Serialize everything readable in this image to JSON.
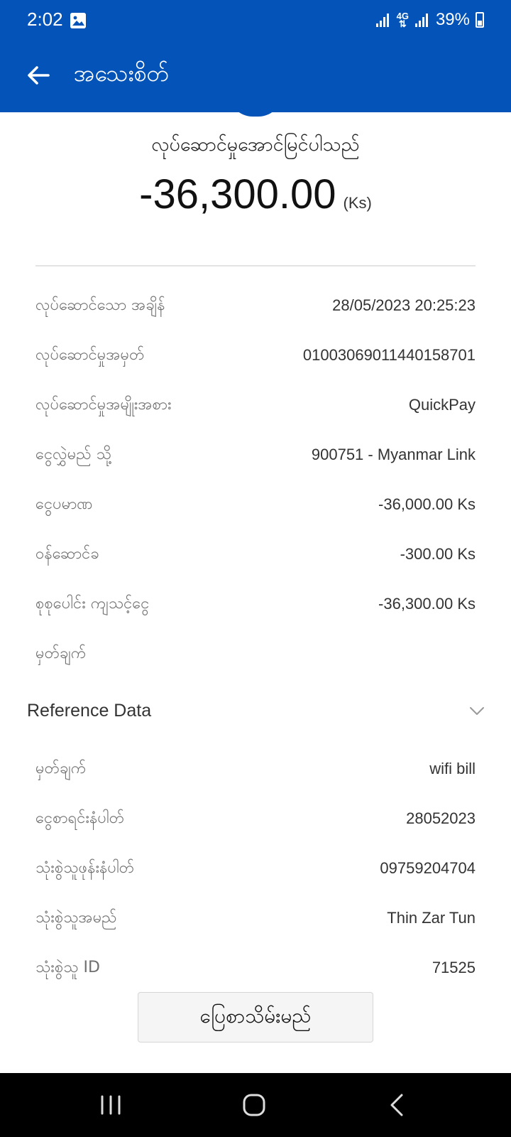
{
  "status_bar": {
    "time": "2:02",
    "network": "4G",
    "battery": "39%",
    "battery_level": 0.39,
    "icons": [
      "gallery-icon",
      "signal-icon",
      "signal-icon",
      "battery-icon"
    ]
  },
  "app_bar": {
    "title": "အသေးစိတ်",
    "back_icon": "arrow-left-icon",
    "color": "#0453b8"
  },
  "summary": {
    "status": "လုပ်ဆောင်မှုအောင်မြင်ပါသည်",
    "amount": "-36,300.00",
    "unit": "(Ks)"
  },
  "details": [
    {
      "label": "လုပ်ဆောင်သော အချိန်",
      "value": "28/05/2023 20:25:23"
    },
    {
      "label": "လုပ်ဆောင်မှုအမှတ်",
      "value": "01003069011440158701"
    },
    {
      "label": "လုပ်ဆောင်မှုအမျိုးအစား",
      "value": "QuickPay"
    },
    {
      "label": "ငွေလွှဲမည် သို့",
      "value": "900751 - Myanmar Link"
    },
    {
      "label": "ငွေပမာဏ",
      "value": "-36,000.00 Ks"
    },
    {
      "label": "ဝန်ဆောင်ခ",
      "value": "-300.00 Ks"
    },
    {
      "label": "စုစုပေါင်း ကျသင့်ငွေ",
      "value": "-36,300.00 Ks"
    },
    {
      "label": "မှတ်ချက်",
      "value": ""
    }
  ],
  "reference": {
    "title": "Reference Data",
    "chevron_icon": "chevron-down-icon",
    "items": [
      {
        "label": "မှတ်ချက်",
        "value": "wifi bill"
      },
      {
        "label": "ငွေစာရင်းနံပါတ်",
        "value": "28052023"
      },
      {
        "label": "သုံးစွဲသူဖုန်းနံပါတ်",
        "value": "09759204704"
      },
      {
        "label": "သုံးစွဲသူအမည်",
        "value": "Thin Zar Tun"
      },
      {
        "label": "သုံးစွဲသူ ID",
        "value": "71525"
      }
    ]
  },
  "print_button": "ပြေစာသိမ်းမည်",
  "nav_bar": {
    "icons": [
      "recents-icon",
      "home-icon",
      "back-icon"
    ]
  }
}
